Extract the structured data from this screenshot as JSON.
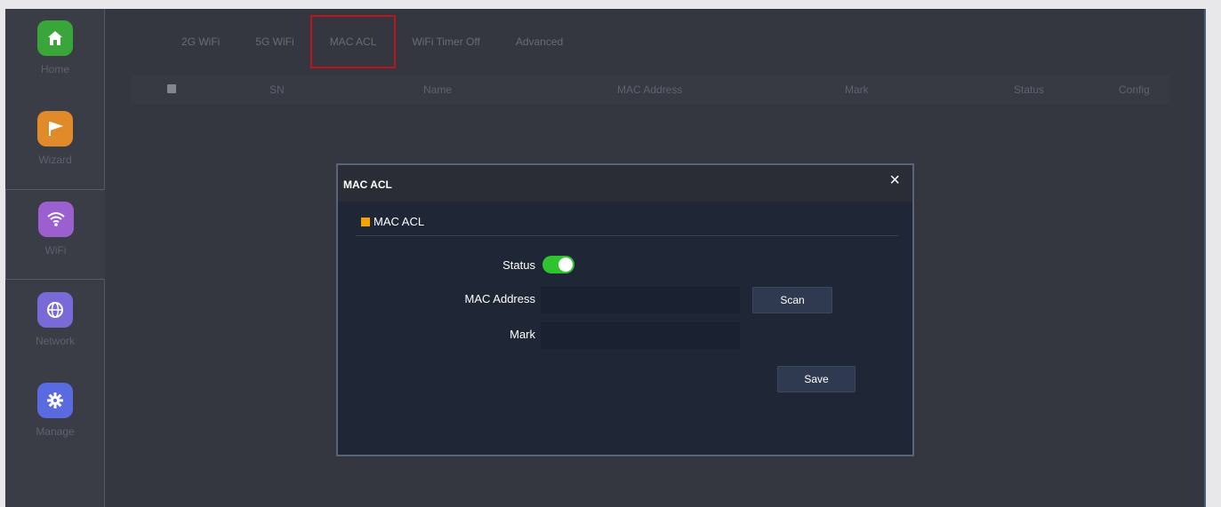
{
  "sidebar": {
    "items": [
      {
        "label": "Home",
        "icon": "home-icon",
        "color": "#3aa63a",
        "glyph": "⌂"
      },
      {
        "label": "Wizard",
        "icon": "flag-icon",
        "color": "#e08a2a",
        "glyph": "⚑"
      },
      {
        "label": "WiFi",
        "icon": "wifi-icon",
        "color": "#9b5fd0",
        "glyph": "◠"
      },
      {
        "label": "Network",
        "icon": "globe-icon",
        "color": "#7a6ad8",
        "glyph": "⊕"
      },
      {
        "label": "Manage",
        "icon": "gear-icon",
        "color": "#5a6ae0",
        "glyph": "⚙"
      }
    ],
    "active": "WiFi"
  },
  "tabs": [
    "2G WiFi",
    "5G WiFi",
    "MAC ACL",
    "WiFi Timer Off",
    "Advanced"
  ],
  "active_tab": "MAC ACL",
  "table": {
    "columns": [
      "SN",
      "Name",
      "MAC Address",
      "Mark",
      "Status",
      "Config"
    ]
  },
  "modal": {
    "title": "MAC ACL",
    "close": "×",
    "section_title": "MAC ACL",
    "status_label": "Status",
    "status_on": true,
    "mac_label": "MAC Address",
    "mac_value": "",
    "mark_label": "Mark",
    "mark_value": "",
    "scan_label": "Scan",
    "save_label": "Save"
  },
  "colors": {
    "accent_orange": "#f5a300",
    "toggle_on": "#2fc32f",
    "highlight_red": "#e0141c"
  }
}
